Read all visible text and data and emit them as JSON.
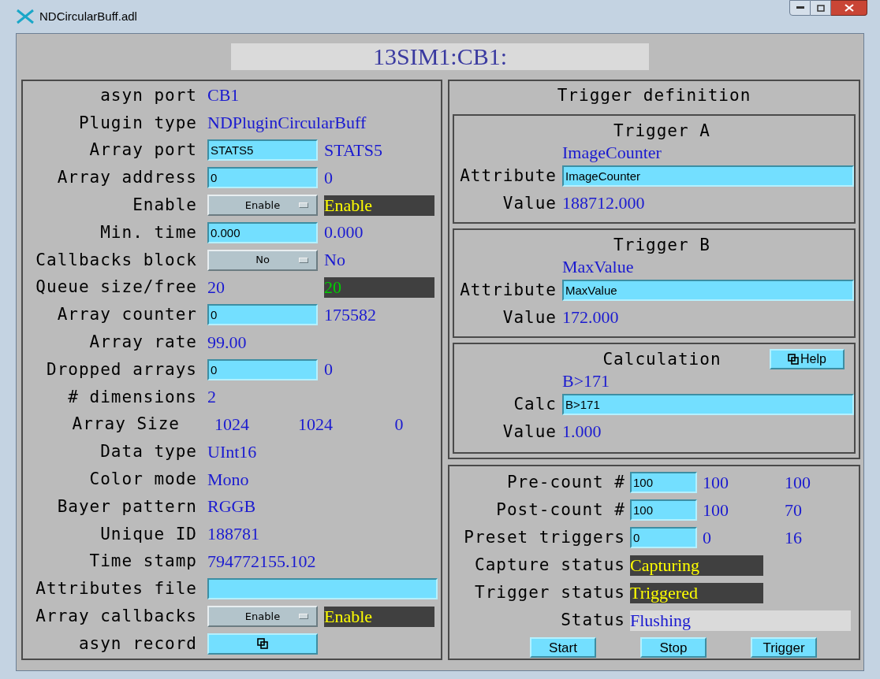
{
  "window": {
    "title": "NDCircularBuff.adl"
  },
  "header": {
    "text": "13SIM1:CB1:"
  },
  "left_panel": {
    "rows": [
      {
        "kind": "text",
        "label": "asyn port",
        "value": "CB1"
      },
      {
        "kind": "text",
        "label": "Plugin type",
        "value": "NDPluginCircularBuff"
      },
      {
        "kind": "input",
        "label": "Array port",
        "value": "STATS5",
        "readback": "STATS5"
      },
      {
        "kind": "input",
        "label": "Array address",
        "value": "0",
        "readback": "0"
      },
      {
        "kind": "menu",
        "label": "Enable",
        "value": "Enable",
        "readback": {
          "text": "Enable",
          "kind": "minor"
        }
      },
      {
        "kind": "input",
        "label": "Min. time",
        "value": "0.000",
        "readback": "0.000"
      },
      {
        "kind": "menu",
        "label": "Callbacks block",
        "value": "No",
        "readback": "No"
      },
      {
        "kind": "pair",
        "label": "Queue size/free",
        "value": "20",
        "readback": {
          "text": "20",
          "kind": "normal"
        }
      },
      {
        "kind": "input",
        "label": "Array counter",
        "value": "0",
        "readback": "175582"
      },
      {
        "kind": "text",
        "label": "Array rate",
        "value": "99.00"
      },
      {
        "kind": "input",
        "label": "Dropped arrays",
        "value": "0",
        "readback": "0"
      },
      {
        "kind": "text",
        "label": "# dimensions",
        "value": "2"
      },
      {
        "kind": "values",
        "label": "Array Size",
        "values": [
          "1024",
          "1024",
          "0"
        ]
      },
      {
        "kind": "text",
        "label": "Data type",
        "value": "UInt16"
      },
      {
        "kind": "text",
        "label": "Color mode",
        "value": "Mono"
      },
      {
        "kind": "text",
        "label": "Bayer pattern",
        "value": "RGGB"
      },
      {
        "kind": "text",
        "label": "Unique ID",
        "value": "188781"
      },
      {
        "kind": "text",
        "label": "Time stamp",
        "value": "794772155.102"
      },
      {
        "kind": "wide_input",
        "label": "Attributes file"
      },
      {
        "kind": "menu",
        "label": "Array callbacks",
        "value": "Enable",
        "readback": {
          "text": "Enable",
          "kind": "minor"
        }
      },
      {
        "kind": "related",
        "label": "asyn record"
      }
    ]
  },
  "trigger_definition": {
    "title": "Trigger definition",
    "triggers": [
      {
        "title": "Trigger A",
        "readback": "ImageCounter",
        "attribute_label": "Attribute",
        "attribute_value": "ImageCounter",
        "value_label": "Value",
        "value": "188712.000"
      },
      {
        "title": "Trigger B",
        "readback": "MaxValue",
        "attribute_label": "Attribute",
        "attribute_value": "MaxValue",
        "value_label": "Value",
        "value": "172.000"
      }
    ],
    "calculation": {
      "title": "Calculation",
      "help_button": "Help",
      "readback": "B>171",
      "calc_label": "Calc",
      "calc_value": "B>171",
      "value_label": "Value",
      "value": "1.000"
    }
  },
  "capture_panel": {
    "rows": [
      {
        "kind": "input",
        "label": "Pre-count #",
        "value": "100",
        "readbacks": [
          "100",
          "100"
        ]
      },
      {
        "kind": "input",
        "label": "Post-count #",
        "value": "100",
        "readbacks": [
          "100",
          "70"
        ]
      },
      {
        "kind": "input",
        "label": "Preset triggers",
        "value": "0",
        "readbacks": [
          "0",
          "16"
        ]
      },
      {
        "kind": "boxed",
        "label": "Capture status",
        "value": {
          "text": "Capturing",
          "kind": "minor"
        }
      },
      {
        "kind": "boxed",
        "label": "Trigger status",
        "value": {
          "text": "Triggered",
          "kind": "minor"
        }
      },
      {
        "kind": "message",
        "label": "Status",
        "value": "Flushing"
      }
    ],
    "buttons": [
      "Start",
      "Stop",
      "Trigger"
    ]
  }
}
